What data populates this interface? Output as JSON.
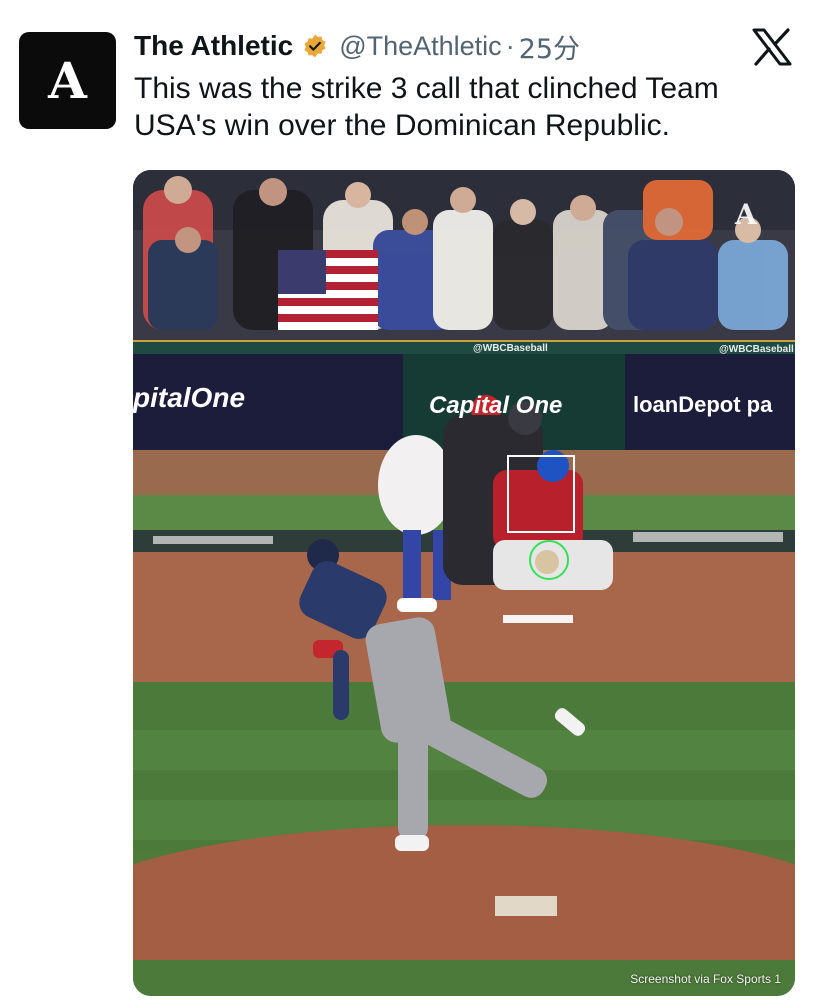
{
  "tweet": {
    "avatar_letter": "A",
    "display_name": "The Athletic",
    "handle": "@TheAthletic",
    "separator": "·",
    "time": "25分",
    "text": "This was the strike 3 call that clinched Team USA's win over the Dominican Republic.",
    "verified_color": "#e8a93a"
  },
  "media": {
    "watermark": "A",
    "ad_left": "pitalOne",
    "ad_center": "Capital One",
    "ad_right": "loanDepot pa",
    "wbc_center": "@WBCBaseball",
    "wbc_right": "@WBCBaseball",
    "credit": "Screenshot via Fox Sports 1"
  },
  "icons": {
    "verified": "verified-badge-icon",
    "x_logo": "x-logo-icon"
  }
}
